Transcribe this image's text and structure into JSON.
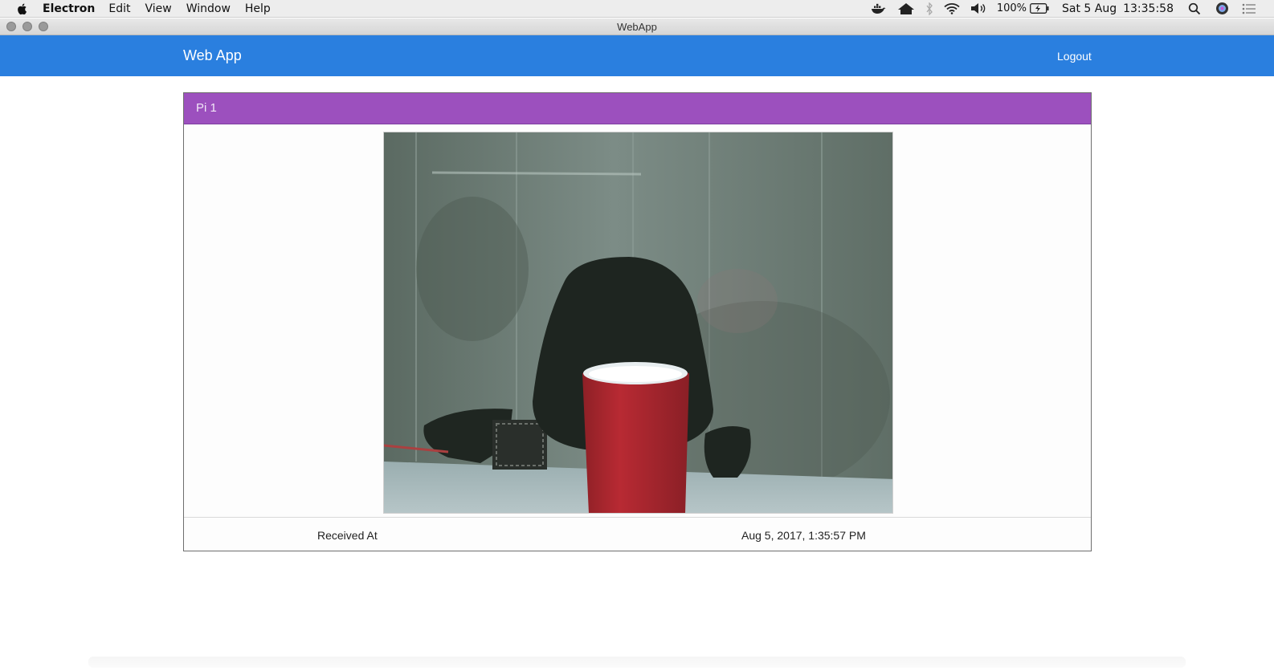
{
  "menubar": {
    "apple_icon": "apple-icon",
    "items": [
      "Electron",
      "Edit",
      "View",
      "Window",
      "Help"
    ],
    "status": {
      "battery_percent": "100%",
      "date": "Sat 5 Aug",
      "time": "13:35:58"
    }
  },
  "window": {
    "title": "WebApp"
  },
  "navbar": {
    "brand": "Web App",
    "logout_label": "Logout",
    "color": "#2a7fdf"
  },
  "card": {
    "title": "Pi 1",
    "header_color": "#9c50be",
    "image_icon": "camera-snapshot",
    "received_label": "Received At",
    "received_value": "Aug 5, 2017, 1:35:57 PM"
  }
}
